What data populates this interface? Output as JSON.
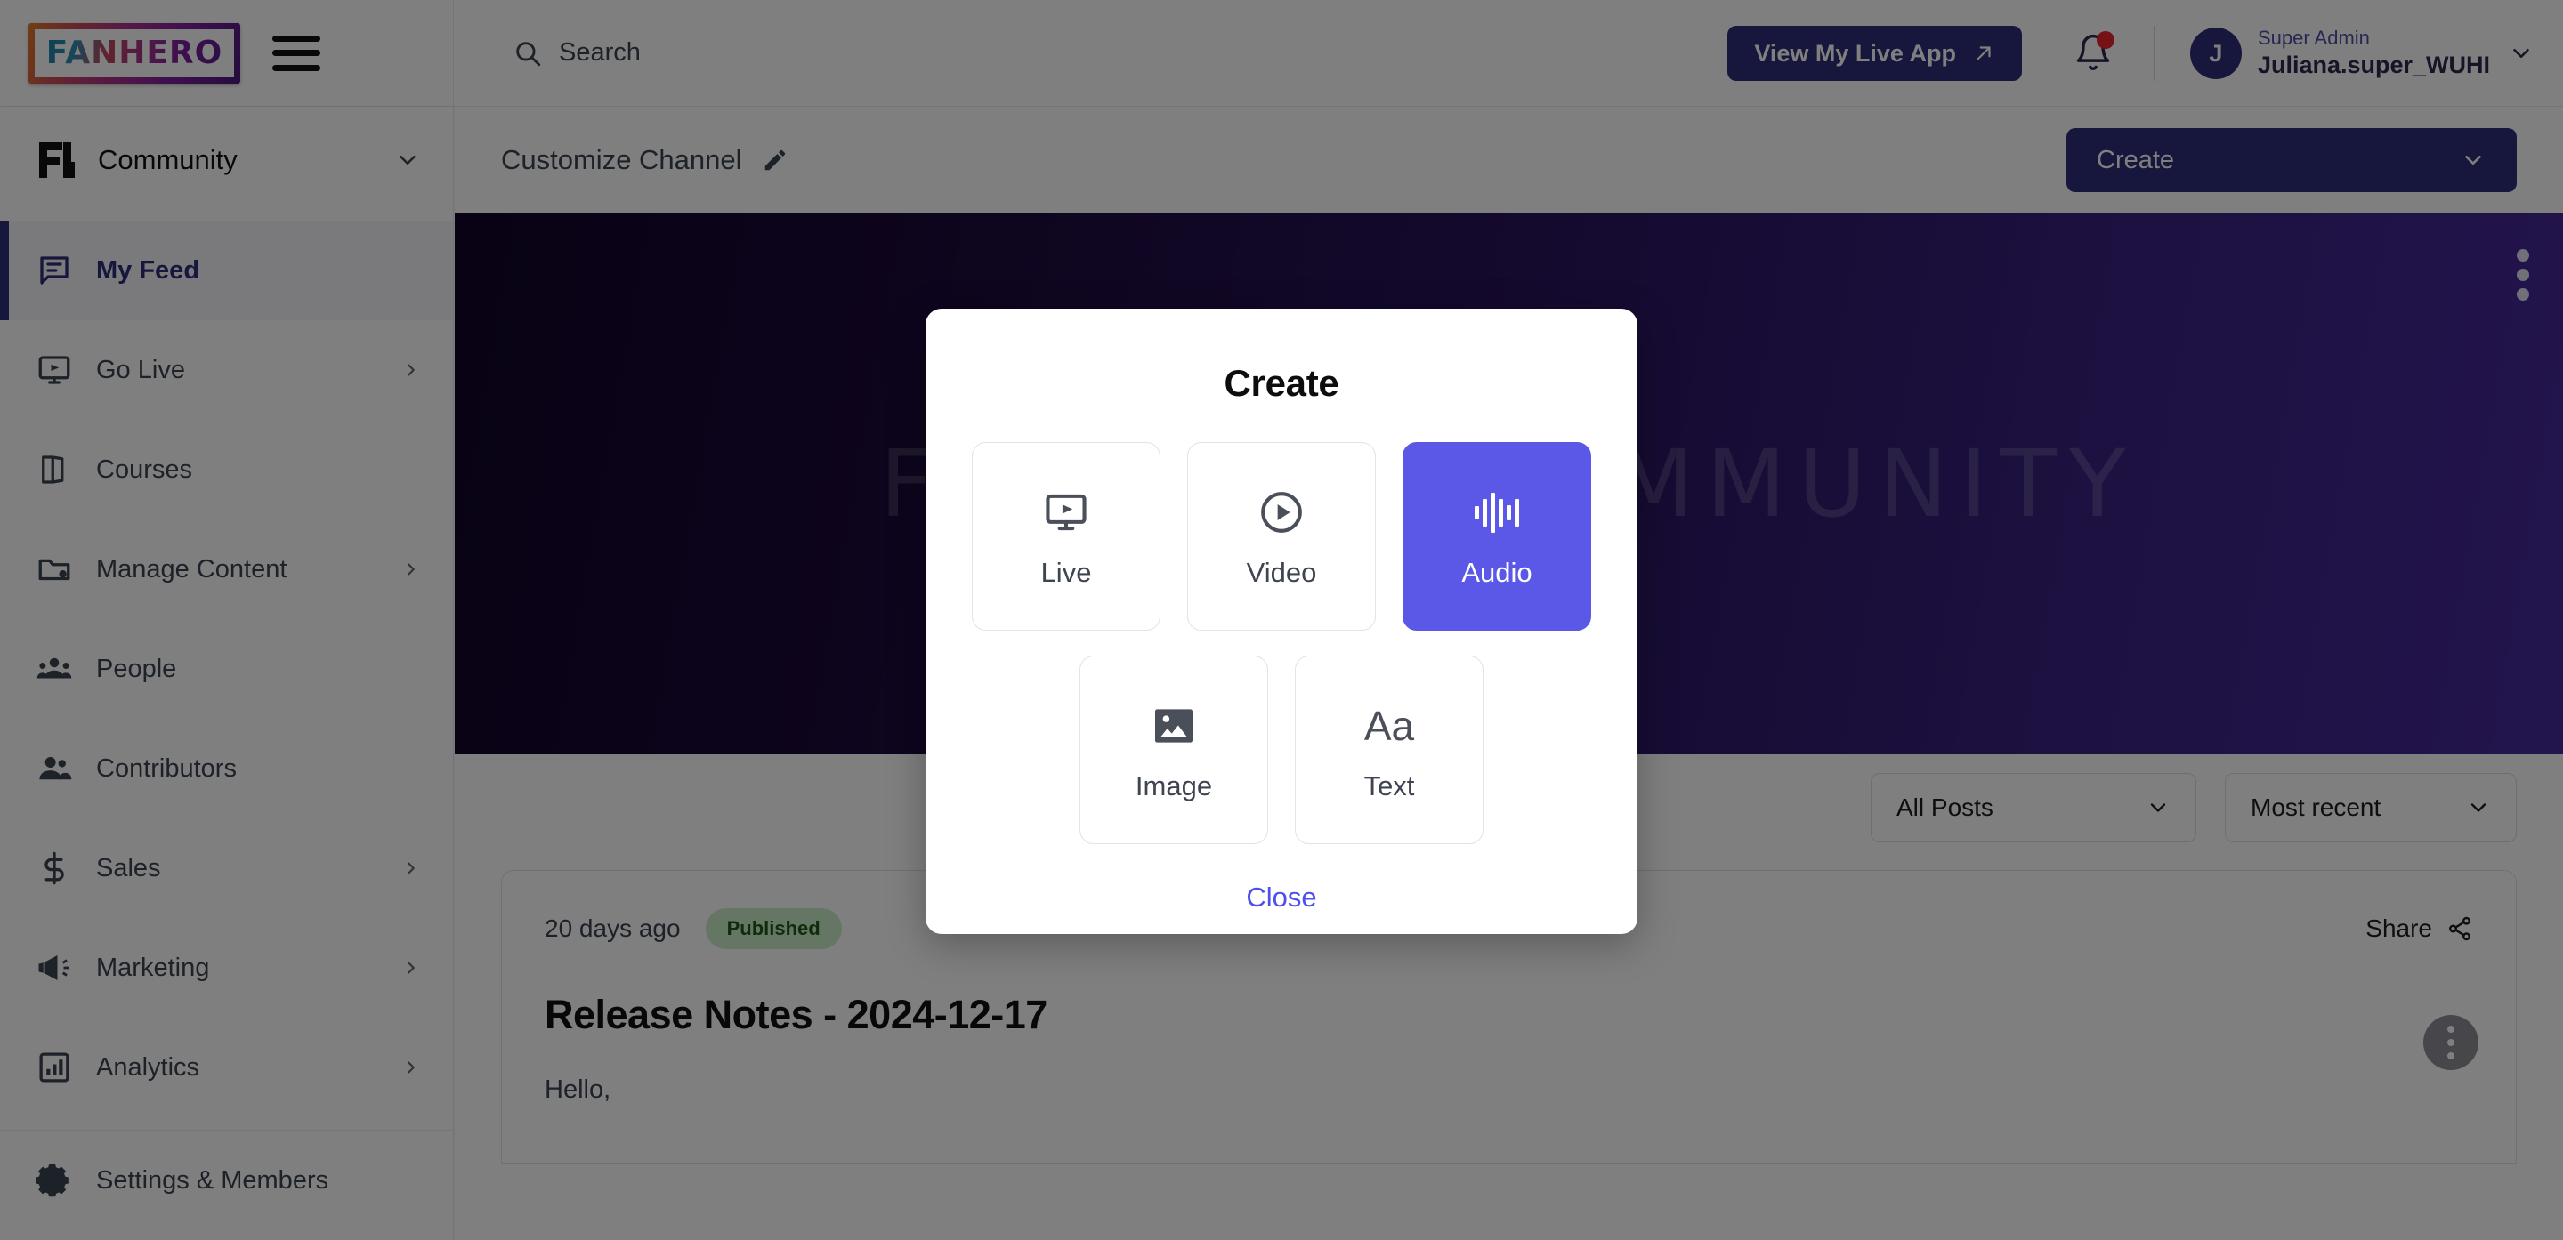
{
  "brand": {
    "logo_text": "FANHERO"
  },
  "topbar": {
    "search_placeholder": "Search",
    "search_icon": "search-icon",
    "menu_icon": "hamburger-menu-icon",
    "live_app_label": "View My Live App",
    "live_app_icon": "arrow-up-right-icon",
    "bell_icon": "notification-bell-icon",
    "has_notification": true,
    "user": {
      "avatar_initial": "J",
      "role": "Super Admin",
      "name": "Juliana.super_WUHI",
      "caret_icon": "chevron-down-icon"
    }
  },
  "sidebar": {
    "workspace": {
      "logo_icon": "fanhero-mark-icon",
      "name": "Community",
      "caret_icon": "chevron-down-icon"
    },
    "items": [
      {
        "label": "My Feed",
        "icon": "feed-icon",
        "active": true,
        "has_chevron": false
      },
      {
        "label": "Go Live",
        "icon": "monitor-play-icon",
        "active": false,
        "has_chevron": true
      },
      {
        "label": "Courses",
        "icon": "book-icon",
        "active": false,
        "has_chevron": false
      },
      {
        "label": "Manage Content",
        "icon": "folder-gear-icon",
        "active": false,
        "has_chevron": true
      },
      {
        "label": "People",
        "icon": "people-group-icon",
        "active": false,
        "has_chevron": false
      },
      {
        "label": "Contributors",
        "icon": "user-pair-icon",
        "active": false,
        "has_chevron": false
      },
      {
        "label": "Sales",
        "icon": "dollar-sign-icon",
        "active": false,
        "has_chevron": true
      },
      {
        "label": "Marketing",
        "icon": "megaphone-icon",
        "active": false,
        "has_chevron": true
      },
      {
        "label": "Analytics",
        "icon": "bar-chart-icon",
        "active": false,
        "has_chevron": true
      }
    ],
    "footer_items": [
      {
        "label": "Settings & Members",
        "icon": "gear-icon"
      }
    ]
  },
  "main": {
    "customize_label": "Customize Channel",
    "customize_icon": "pencil-edit-icon",
    "create_label": "Create",
    "create_caret_icon": "chevron-down-icon",
    "banner": {
      "title": "FANHERO COMMUNITY",
      "kebab_icon": "more-vertical-icon"
    },
    "filters": {
      "posts_value": "All Posts",
      "sort_value": "Most recent",
      "caret_icon": "chevron-down-icon"
    },
    "post": {
      "date": "20 days ago",
      "status": "Published",
      "share_label": "Share",
      "share_icon": "share-icon",
      "title": "Release Notes - 2024-12-17",
      "body": "Hello,",
      "kebab_icon": "more-vertical-icon"
    }
  },
  "modal": {
    "title": "Create",
    "close_label": "Close",
    "row1": [
      {
        "label": "Live",
        "icon": "monitor-play-icon",
        "selected": false
      },
      {
        "label": "Video",
        "icon": "play-circle-icon",
        "selected": false
      },
      {
        "label": "Audio",
        "icon": "audio-waveform-icon",
        "selected": true
      }
    ],
    "row2": [
      {
        "label": "Image",
        "icon": "image-icon",
        "selected": false
      },
      {
        "label": "Text",
        "icon": "text-aa-icon",
        "selected": false
      }
    ]
  },
  "colors": {
    "brand_navy": "#2e2e7a",
    "accent_indigo": "#5b58e8",
    "link_blue": "#4f4ff0",
    "badge_green_bg": "#cdecc8",
    "badge_green_fg": "#1d5a17",
    "notification_red": "#e8242c"
  }
}
